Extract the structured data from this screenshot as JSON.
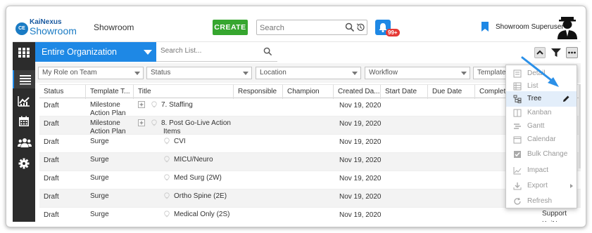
{
  "header": {
    "logo_top": "KaiNexus",
    "logo_bottom": "Showroom",
    "logo_badge": "CE",
    "app_title": "Showroom",
    "create_label": "CREATE",
    "search_placeholder": "Search",
    "notification_count": "99+",
    "user_name": "Showroom Superuser",
    "accent_color": "#1e88e5",
    "create_color": "#36a62f",
    "badge_color": "#e53935"
  },
  "nav": {
    "icons": [
      "apps-grid-icon",
      "list-icon",
      "chart-icon",
      "calendar-icon",
      "people-icon",
      "gear-icon"
    ]
  },
  "toolbar": {
    "organization": "Entire Organization",
    "list_search_placeholder": "Search List..."
  },
  "filters": [
    "My Role on Team",
    "Status",
    "Location",
    "Workflow",
    "Template T"
  ],
  "table": {
    "columns": [
      "Status",
      "Template T...",
      "Title",
      "Responsible",
      "Champion",
      "Created Da...",
      "Start Date",
      "Due Date",
      "Complet"
    ],
    "rows": [
      {
        "status": "Draft",
        "template_1": "Milestone",
        "template_2": "Action Plan",
        "title_1": "7. Staffing",
        "title_2": "",
        "created": "Nov 19, 2020",
        "expandable": true
      },
      {
        "status": "Draft",
        "template_1": "Milestone",
        "template_2": "Action Plan",
        "title_1": "8. Post Go-Live Action",
        "title_2": "Items",
        "created": "Nov 19, 2020",
        "expandable": true
      },
      {
        "status": "Draft",
        "template_1": "Surge",
        "template_2": "",
        "title_1": "CVI",
        "title_2": "",
        "created": "Nov 19, 2020",
        "expandable": false
      },
      {
        "status": "Draft",
        "template_1": "Surge",
        "template_2": "",
        "title_1": "MICU/Neuro",
        "title_2": "",
        "created": "Nov 19, 2020",
        "expandable": false
      },
      {
        "status": "Draft",
        "template_1": "Surge",
        "template_2": "",
        "title_1": "Med Surg (2W)",
        "title_2": "",
        "created": "Nov 19, 2020",
        "expandable": false
      },
      {
        "status": "Draft",
        "template_1": "Surge",
        "template_2": "",
        "title_1": "Ortho Spine (2E)",
        "title_2": "",
        "created": "Nov 19, 2020",
        "expandable": false
      },
      {
        "status": "Draft",
        "template_1": "Surge",
        "template_2": "",
        "title_1": "Medical Only (2S)",
        "title_2": "",
        "created": "Nov 19, 2020",
        "expandable": false
      }
    ],
    "overflow_owner_lines": [
      "Support",
      "KaiNexus",
      "Support"
    ]
  },
  "view_menu": {
    "items": [
      {
        "label": "Detail",
        "icon": "detail-icon",
        "selected": false
      },
      {
        "label": "List",
        "icon": "list-view-icon",
        "selected": false
      },
      {
        "label": "Tree",
        "icon": "tree-icon",
        "selected": true
      },
      {
        "label": "Kanban",
        "icon": "kanban-icon",
        "selected": false
      },
      {
        "label": "Gantt",
        "icon": "gantt-icon",
        "selected": false
      },
      {
        "label": "Calendar",
        "icon": "calendar-view-icon",
        "selected": false
      },
      {
        "label": "Bulk Change",
        "icon": "checkbox-icon",
        "selected": false
      },
      {
        "label": "Impact",
        "icon": "impact-chart-icon",
        "selected": false
      },
      {
        "label": "Export",
        "icon": "export-icon",
        "selected": false
      },
      {
        "label": "Refresh",
        "icon": "refresh-icon",
        "selected": false
      }
    ]
  }
}
